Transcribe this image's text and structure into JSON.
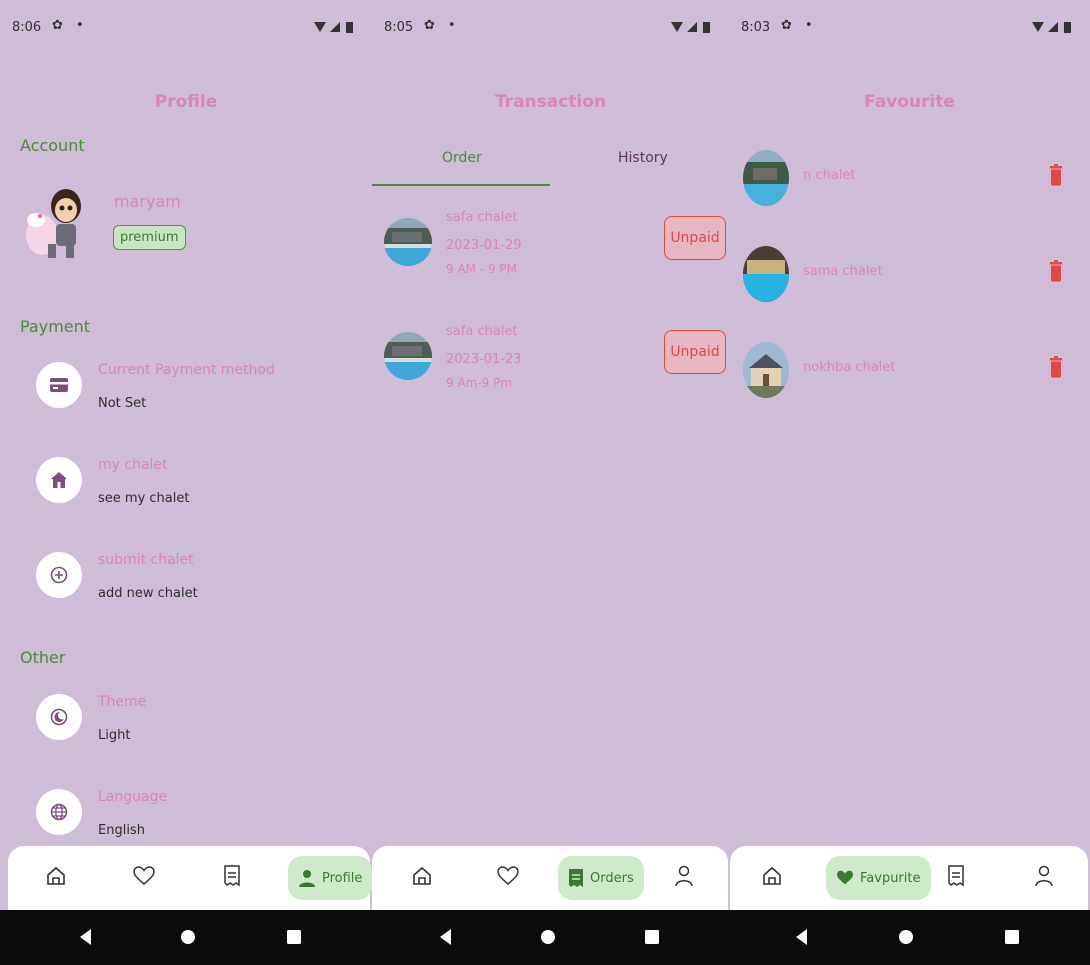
{
  "screens": {
    "profile": {
      "status": {
        "time": "8:06"
      },
      "title": "Profile",
      "sections": {
        "account": "Account",
        "payment": "Payment",
        "other": "Other"
      },
      "user": {
        "name": "maryam",
        "badge": "premium"
      },
      "settings": [
        {
          "label": "Current Payment method",
          "value": "Not Set",
          "icon": "credit-card-icon"
        },
        {
          "label": "my chalet",
          "value": "see my chalet",
          "icon": "home-icon"
        },
        {
          "label": "submit chalet",
          "value": "add new chalet",
          "icon": "add-circle-icon"
        },
        {
          "label": "Theme",
          "value": "Light",
          "icon": "moon-icon"
        },
        {
          "label": "Language",
          "value": "English",
          "icon": "globe-icon"
        }
      ],
      "nav": {
        "active_label": "Profile"
      }
    },
    "orders": {
      "status": {
        "time": "8:05"
      },
      "title": "Transaction",
      "tabs": [
        "Order",
        "History"
      ],
      "items": [
        {
          "name": "safa chalet",
          "date": "2023-01-29",
          "hours": "9 AM - 9 PM",
          "status": "Unpaid"
        },
        {
          "name": "safa chalet",
          "date": "2023-01-23",
          "hours": "9 Am-9 Pm",
          "status": "Unpaid"
        }
      ],
      "nav": {
        "active_label": "Orders"
      }
    },
    "favourite": {
      "status": {
        "time": "8:03"
      },
      "title": "Favourite",
      "items": [
        {
          "name": "n chalet"
        },
        {
          "name": "sama chalet"
        },
        {
          "name": "nokhba chalet"
        }
      ],
      "nav": {
        "active_label": "Favpurite"
      }
    }
  },
  "colors": {
    "background": "#cfbcd6",
    "accent_pink": "#d986b5",
    "accent_green": "#4d8a3a",
    "danger": "#e34848",
    "pill": "#cfe9cb"
  }
}
